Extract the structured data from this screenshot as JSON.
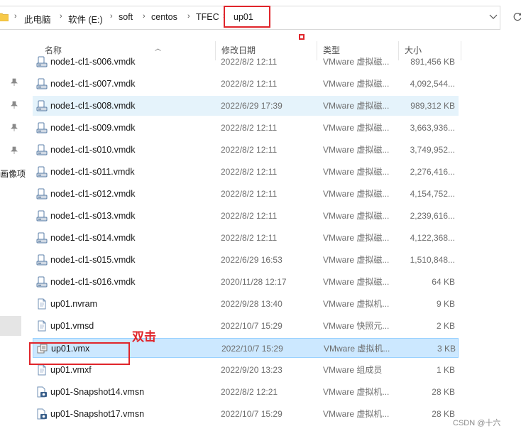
{
  "address_bar": {
    "crumbs": [
      "此电脑",
      "软件 (E:)",
      "soft",
      "centos",
      "TFEC",
      "up01"
    ]
  },
  "left_pane": {
    "label": "画像项"
  },
  "columns": {
    "name": "名称",
    "date": "修改日期",
    "type": "类型",
    "size": "大小"
  },
  "files": [
    {
      "name": "node1-cl1-s006.vmdk",
      "date": "2022/8/2 12:11",
      "type": "VMware 虚拟磁...",
      "size": "891,456 KB",
      "icon": "vmdk-disk-icon"
    },
    {
      "name": "node1-cl1-s007.vmdk",
      "date": "2022/8/2 12:11",
      "type": "VMware 虚拟磁...",
      "size": "4,092,544...",
      "icon": "vmdk-disk-icon"
    },
    {
      "name": "node1-cl1-s008.vmdk",
      "date": "2022/6/29 17:39",
      "type": "VMware 虚拟磁...",
      "size": "989,312 KB",
      "icon": "vmdk-disk-icon"
    },
    {
      "name": "node1-cl1-s009.vmdk",
      "date": "2022/8/2 12:11",
      "type": "VMware 虚拟磁...",
      "size": "3,663,936...",
      "icon": "vmdk-disk-icon"
    },
    {
      "name": "node1-cl1-s010.vmdk",
      "date": "2022/8/2 12:11",
      "type": "VMware 虚拟磁...",
      "size": "3,749,952...",
      "icon": "vmdk-disk-icon"
    },
    {
      "name": "node1-cl1-s011.vmdk",
      "date": "2022/8/2 12:11",
      "type": "VMware 虚拟磁...",
      "size": "2,276,416...",
      "icon": "vmdk-disk-icon"
    },
    {
      "name": "node1-cl1-s012.vmdk",
      "date": "2022/8/2 12:11",
      "type": "VMware 虚拟磁...",
      "size": "4,154,752...",
      "icon": "vmdk-disk-icon"
    },
    {
      "name": "node1-cl1-s013.vmdk",
      "date": "2022/8/2 12:11",
      "type": "VMware 虚拟磁...",
      "size": "2,239,616...",
      "icon": "vmdk-disk-icon"
    },
    {
      "name": "node1-cl1-s014.vmdk",
      "date": "2022/8/2 12:11",
      "type": "VMware 虚拟磁...",
      "size": "4,122,368...",
      "icon": "vmdk-disk-icon"
    },
    {
      "name": "node1-cl1-s015.vmdk",
      "date": "2022/6/29 16:53",
      "type": "VMware 虚拟磁...",
      "size": "1,510,848...",
      "icon": "vmdk-disk-icon"
    },
    {
      "name": "node1-cl1-s016.vmdk",
      "date": "2020/11/28 12:17",
      "type": "VMware 虚拟磁...",
      "size": "64 KB",
      "icon": "vmdk-disk-icon"
    },
    {
      "name": "up01.nvram",
      "date": "2022/9/28 13:40",
      "type": "VMware 虚拟机...",
      "size": "9 KB",
      "icon": "document-icon"
    },
    {
      "name": "up01.vmsd",
      "date": "2022/10/7 15:29",
      "type": "VMware 快照元...",
      "size": "2 KB",
      "icon": "document-icon"
    },
    {
      "name": "up01.vmx",
      "date": "2022/10/7 15:29",
      "type": "VMware 虚拟机...",
      "size": "3 KB",
      "icon": "vmx-icon"
    },
    {
      "name": "up01.vmxf",
      "date": "2022/9/20 13:23",
      "type": "VMware 组成员",
      "size": "1 KB",
      "icon": "document-icon"
    },
    {
      "name": "up01-Snapshot14.vmsn",
      "date": "2022/8/2 12:21",
      "type": "VMware 虚拟机...",
      "size": "28 KB",
      "icon": "snapshot-icon"
    },
    {
      "name": "up01-Snapshot17.vmsn",
      "date": "2022/10/7 15:29",
      "type": "VMware 虚拟机...",
      "size": "28 KB",
      "icon": "snapshot-icon"
    }
  ],
  "row_states": {
    "hover_index": 2,
    "selected_index": 13
  },
  "annotation": {
    "text": "双击"
  },
  "watermark": "CSDN @十六",
  "colors": {
    "accent_red": "#e0252b",
    "selected_bg": "#cce8ff",
    "hover_bg": "#e5f3fb"
  }
}
